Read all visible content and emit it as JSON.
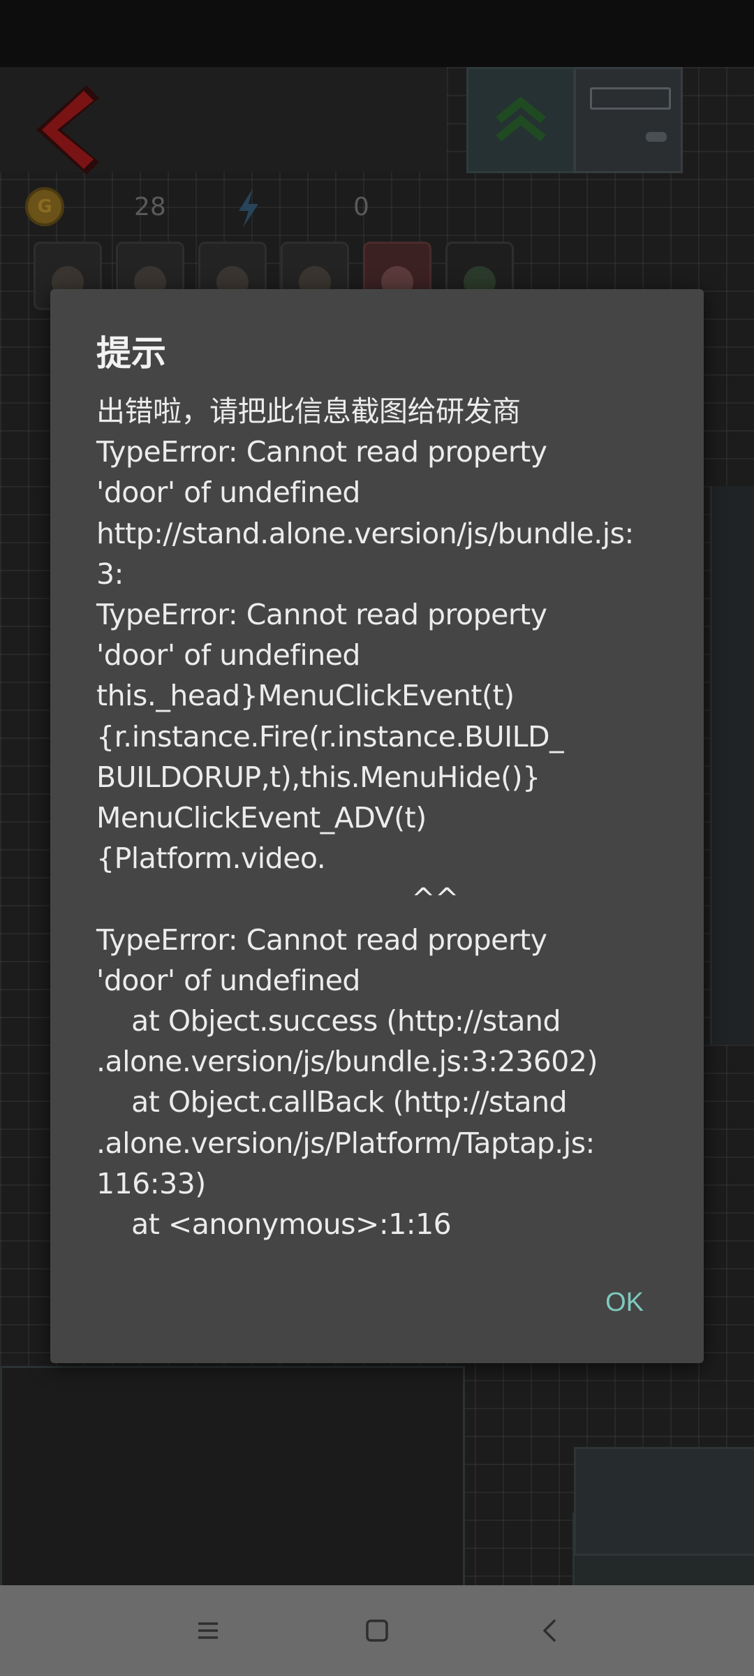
{
  "game": {
    "coin_icon_letter": "G",
    "gold_value": "28",
    "energy_value": "0",
    "avatars": [
      "character-1",
      "character-2",
      "character-3",
      "character-4",
      "character-5",
      "character-6"
    ]
  },
  "dialog": {
    "title": "提示",
    "message_lines": [
      "出错啦，请把此信息截图给研发商",
      "TypeError: Cannot read property",
      "'door' of undefined",
      "http://stand.alone.version/js/bundle.js:",
      "3:",
      "TypeError: Cannot read property",
      "'door' of undefined",
      "this._head}MenuClickEvent(t)",
      "{r.instance.Fire(r.instance.BUILD_",
      "BUILDORUP,t),this.MenuHide()}",
      "MenuClickEvent_ADV(t)",
      "{Platform.video.",
      "                                    ^^",
      "TypeError: Cannot read property",
      "'door' of undefined",
      "    at Object.success (http://stand",
      ".alone.version/js/bundle.js:3:23602)",
      "    at Object.callBack (http://stand",
      ".alone.version/js/Platform/Taptap.js:",
      "116:33)",
      "    at <anonymous>:1:16"
    ],
    "ok_label": "OK"
  },
  "navbar": {
    "icons": [
      "menu-icon",
      "home-icon",
      "back-icon"
    ]
  },
  "colors": {
    "dialog_bg": "#454545",
    "ok_text": "#7fc9bf",
    "back_arrow": "#7a1414",
    "navbar_bg": "#6b6b6b"
  }
}
